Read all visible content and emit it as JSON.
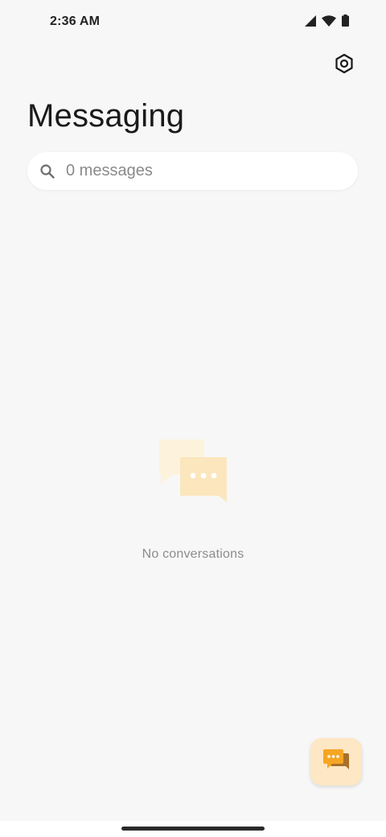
{
  "status_bar": {
    "time": "2:36 AM",
    "icons": [
      "signal-icon",
      "wifi-icon",
      "battery-icon"
    ]
  },
  "header": {
    "title": "Messaging",
    "settings_icon": "settings-gear-icon"
  },
  "search": {
    "placeholder": "0 messages",
    "value": "",
    "icon": "search-icon"
  },
  "empty_state": {
    "icon": "chat-bubbles-icon",
    "message": "No conversations"
  },
  "fab": {
    "icon": "new-conversation-icon",
    "aria_label": "Start chat"
  },
  "colors": {
    "background": "#f7f7f7",
    "accent": "#f5a623",
    "fab_background": "#fde7c4",
    "empty_icon_light": "#fdf3dc",
    "empty_icon_main": "#fbe6bd"
  }
}
